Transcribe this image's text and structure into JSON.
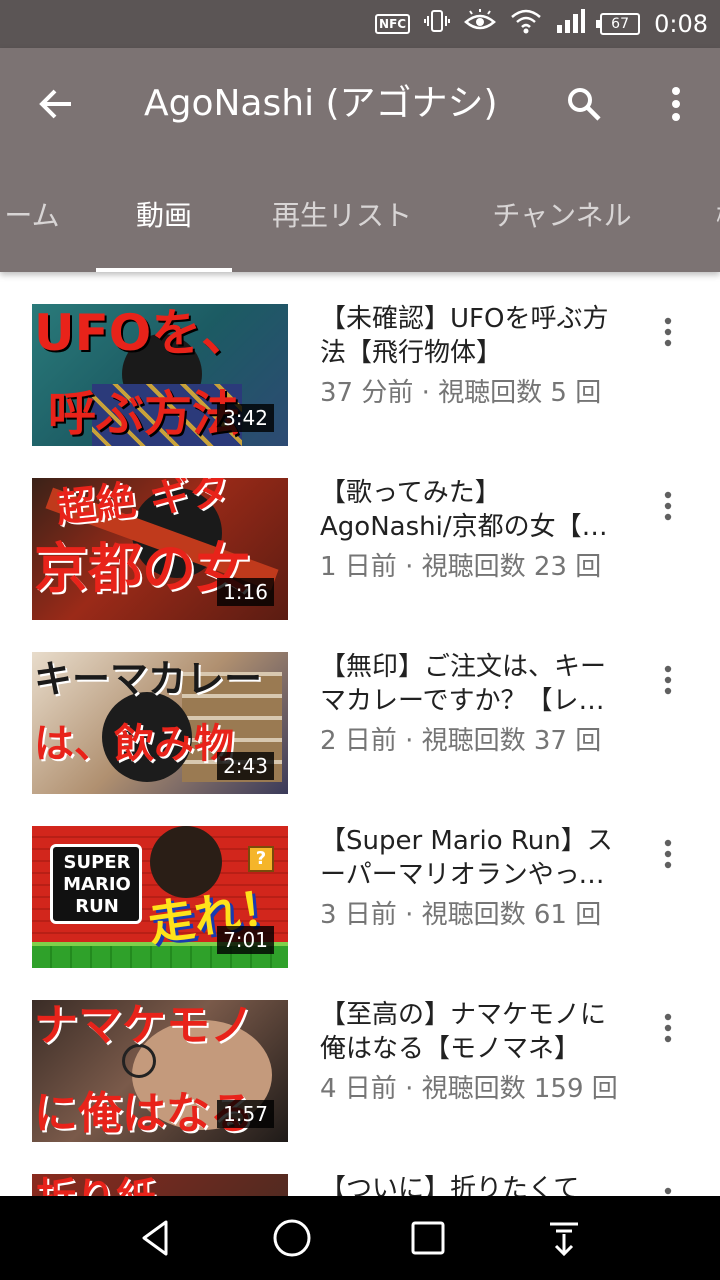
{
  "status_bar": {
    "nfc": "NFC",
    "battery": "67",
    "time": "0:08",
    "icons": [
      "nfc-icon",
      "vibrate-icon",
      "eye-icon",
      "wifi-icon",
      "signal-icon",
      "battery-icon"
    ]
  },
  "appbar": {
    "title": "AgoNashi (アゴナシ)",
    "background": "#7c7373"
  },
  "tabs": [
    {
      "label": "ーム"
    },
    {
      "label": "動画",
      "active": true
    },
    {
      "label": "再生リスト"
    },
    {
      "label": "チャンネル"
    },
    {
      "label": "概"
    }
  ],
  "videos": [
    {
      "title": "【未確認】UFOを呼ぶ方法【飛行物体】",
      "meta": "37 分前 · 視聴回数 5 回",
      "duration": "3:42",
      "thumb_text_1": "UFOを、",
      "thumb_text_2": "呼ぶ方法",
      "thumb_color": "#1f6b6b"
    },
    {
      "title": "【歌ってみた】AgoNashi/京都の女【歌詞付き】",
      "meta": "1 日前 · 視聴回数 23 回",
      "duration": "1:16",
      "thumb_text_1": "超絶 ギタ",
      "thumb_text_2": "京都の女",
      "thumb_color": "#8a1f12"
    },
    {
      "title": "【無印】ご注文は、キーマカレーですか？【レビュー】",
      "meta": "2 日前 · 視聴回数 37 回",
      "duration": "2:43",
      "thumb_text_1": "キーマカレー",
      "thumb_text_2": "は、飲み物",
      "thumb_color": "#6a5a48"
    },
    {
      "title": "【Super Mario Run】スーパーマリオランやってみた",
      "meta": "3 日前 · 視聴回数 61 回",
      "duration": "7:01",
      "thumb_text_1": "SUPER MARIO RUN",
      "thumb_text_2": "走れ！",
      "thumb_color": "#c4201a"
    },
    {
      "title": "【至高の】ナマケモノに俺はなる【モノマネ】",
      "meta": "4 日前 · 視聴回数 159 回",
      "duration": "1:57",
      "thumb_text_1": "ナマケモノ",
      "thumb_text_2": "に俺はなる",
      "thumb_color": "#2a2320"
    },
    {
      "title": "【ついに】折りたくて",
      "meta": "",
      "duration": "",
      "thumb_text_1": "折り紙",
      "thumb_text_2": "",
      "thumb_color": "#b52a1e"
    }
  ],
  "navbar": {
    "icons": [
      "back-triangle-icon",
      "home-circle-icon",
      "recents-square-icon",
      "notification-pull-icon"
    ]
  }
}
